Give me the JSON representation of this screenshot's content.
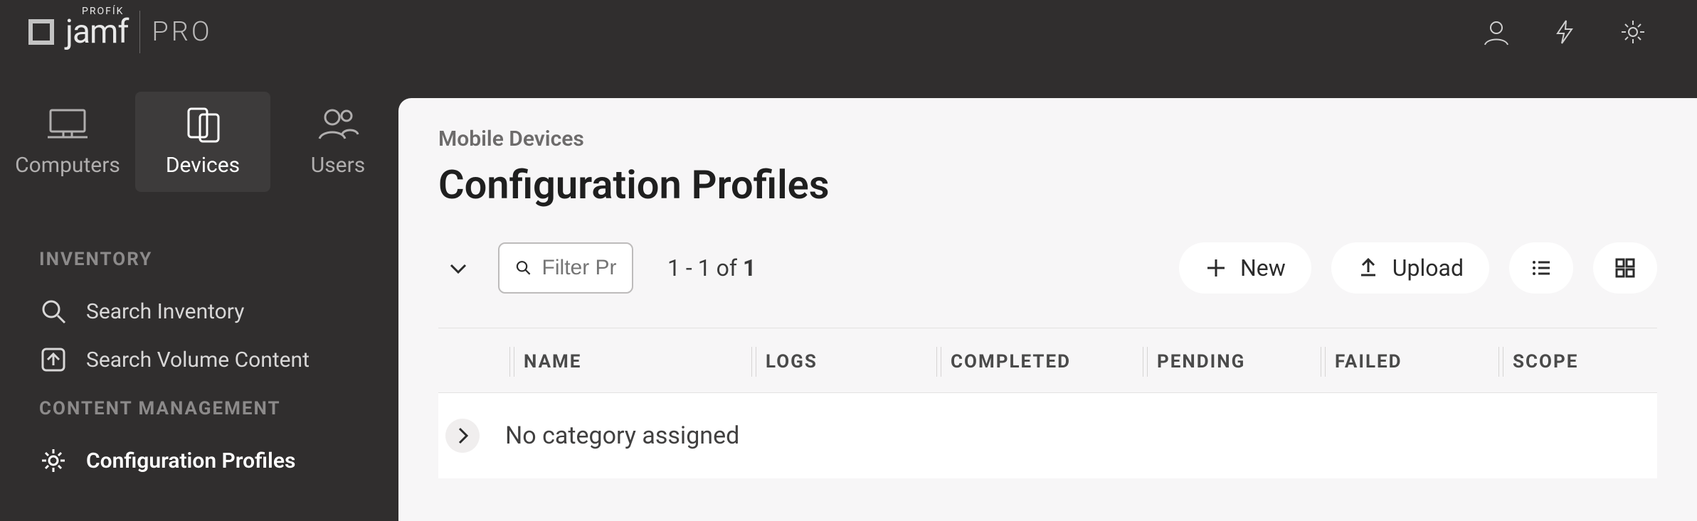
{
  "brand": {
    "top_label": "PROFÍK",
    "word": "jamf",
    "suffix": "PRO"
  },
  "nav": {
    "computers": "Computers",
    "devices": "Devices",
    "users": "Users"
  },
  "sidebar": {
    "section_inventory": "INVENTORY",
    "search_inventory": "Search Inventory",
    "search_volume": "Search Volume Content",
    "section_content": "CONTENT MANAGEMENT",
    "config_profiles": "Configuration Profiles"
  },
  "main": {
    "breadcrumb": "Mobile Devices",
    "title": "Configuration Profiles",
    "filter_placeholder": "Filter Pr",
    "range_prefix": "1 - 1 of ",
    "range_total": "1",
    "new_btn": "New",
    "upload_btn": "Upload",
    "columns": {
      "name": "NAME",
      "logs": "LOGS",
      "completed": "COMPLETED",
      "pending": "PENDING",
      "failed": "FAILED",
      "scope": "SCOPE"
    },
    "group_row": "No category assigned"
  }
}
